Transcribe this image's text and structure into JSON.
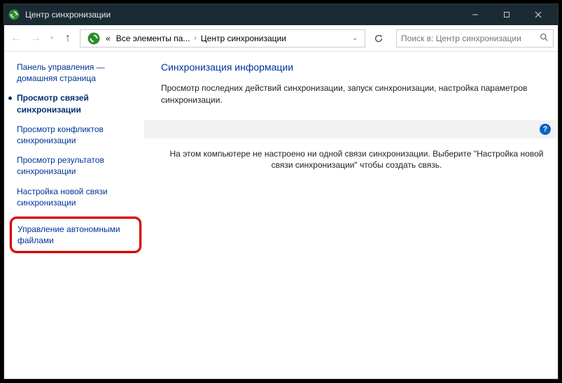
{
  "window": {
    "title": "Центр синхронизации"
  },
  "toolbar": {
    "breadcrumb_prefix": "«",
    "crumb1": "Все элементы па...",
    "crumb2": "Центр синхронизации",
    "search_placeholder": "Поиск в: Центр синхронизации"
  },
  "sidebar": {
    "home": "Панель управления — домашняя страница",
    "items": [
      "Просмотр связей синхронизации",
      "Просмотр конфликтов синхронизации",
      "Просмотр результатов синхронизации",
      "Настройка новой связи синхронизации",
      "Управление автономными файлами"
    ]
  },
  "main": {
    "heading": "Синхронизация информации",
    "description": "Просмотр последних действий синхронизации, запуск синхронизации, настройка параметров синхронизации.",
    "empty": "На этом компьютере не настроено ни одной связи синхронизации. Выберите \"Настройка новой связи синхронизации\" чтобы создать связь."
  }
}
